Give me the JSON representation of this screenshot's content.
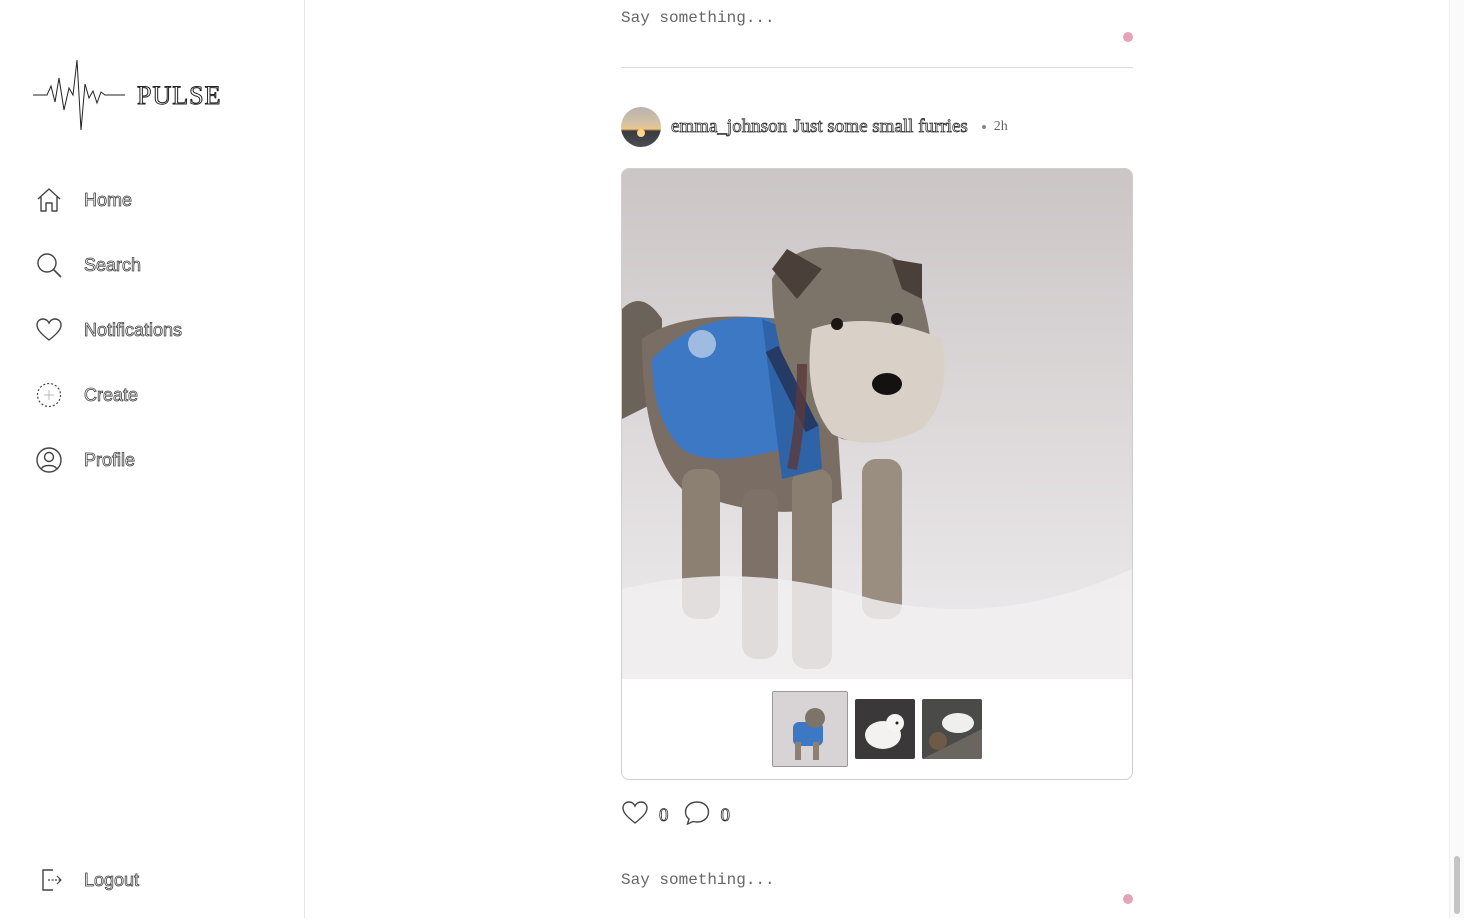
{
  "app": {
    "name": "PULSE"
  },
  "sidebar": {
    "items": [
      {
        "label": "Home",
        "icon": "home-icon"
      },
      {
        "label": "Search",
        "icon": "search-icon"
      },
      {
        "label": "Notifications",
        "icon": "heart-icon"
      },
      {
        "label": "Create",
        "icon": "create-icon"
      },
      {
        "label": "Profile",
        "icon": "profile-icon"
      }
    ],
    "logout": {
      "label": "Logout",
      "icon": "logout-icon"
    }
  },
  "comment_input": {
    "placeholder": "Say something..."
  },
  "post": {
    "username": "emma_johnson",
    "caption": "Just some small furries",
    "time": "2h",
    "image_count": 3,
    "active_image": 1,
    "likes": "0",
    "comments": "0"
  },
  "colors": {
    "send_dot": "#e3a4b8",
    "divider": "#dcdcdc"
  }
}
